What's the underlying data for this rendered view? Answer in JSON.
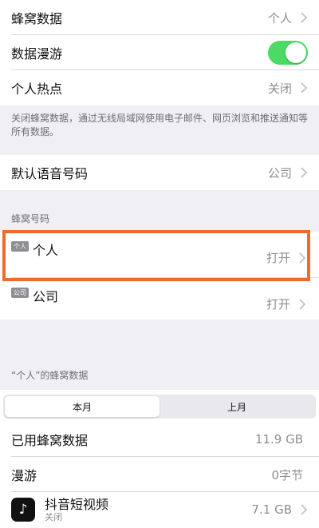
{
  "rows_top": {
    "cellular_data": {
      "label": "蜂窝数据",
      "value": "个人"
    },
    "data_roaming": {
      "label": "数据漫游",
      "enabled": true
    },
    "personal_hotspot": {
      "label": "个人热点",
      "value": "关闭"
    }
  },
  "note_text": "关闭蜂窝数据，通过无线局域网使用电子邮件、网页浏览和推送通知等所有数据。",
  "default_voice": {
    "label": "默认语音号码",
    "value": "公司"
  },
  "lines_section": {
    "header": "蜂窝号码",
    "lines": [
      {
        "badge": "个人",
        "label": "个人",
        "value": "打开"
      },
      {
        "badge": "公司",
        "label": "公司",
        "value": "打开"
      }
    ]
  },
  "usage_section": {
    "header": "“个人”的蜂窝数据",
    "segments": [
      {
        "label": "本月",
        "active": true
      },
      {
        "label": "上月",
        "active": false
      }
    ],
    "used": {
      "label": "已用蜂窝数据",
      "value": "11.9 GB"
    },
    "roaming": {
      "label": "漫游",
      "value": "0字节"
    },
    "app": {
      "name": "抖音短视频",
      "status": "关闭",
      "value": "7.1 GB",
      "icon": "tiktok-icon"
    }
  },
  "colors": {
    "toggle_on": "#4cd964",
    "highlight": "#f06a2f"
  }
}
